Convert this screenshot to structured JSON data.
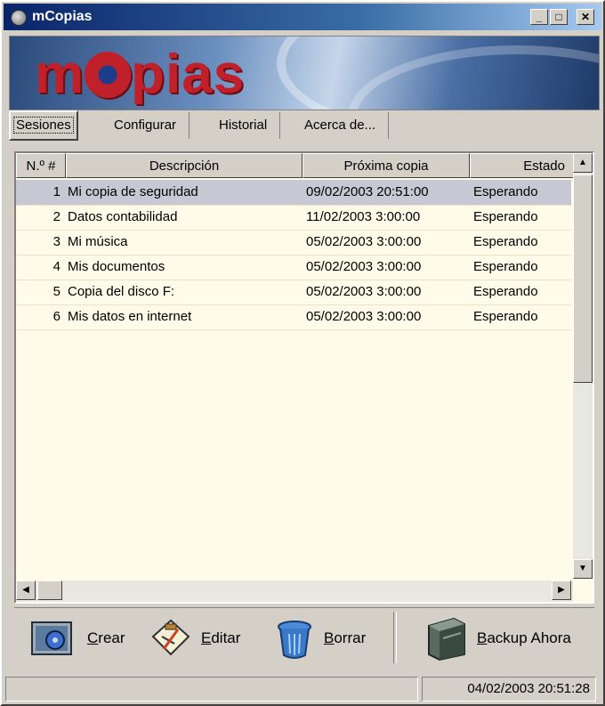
{
  "window": {
    "title": "mCopias"
  },
  "titlebar_buttons": {
    "minimize": "_",
    "maximize": "□",
    "close": "✕"
  },
  "banner": {
    "logo_left": "m",
    "logo_right": "pias"
  },
  "tabs": [
    {
      "label": "Sesiones",
      "active": true
    },
    {
      "label": "Configurar",
      "active": false
    },
    {
      "label": "Historial",
      "active": false
    },
    {
      "label": "Acerca de...",
      "active": false
    }
  ],
  "table": {
    "columns": [
      "N.º #",
      "Descripción",
      "Próxima copia",
      "Estado"
    ],
    "rows": [
      {
        "n": "1",
        "descripcion": "Mi copia de seguridad",
        "proxima": "09/02/2003 20:51:00",
        "estado": "Esperando"
      },
      {
        "n": "2",
        "descripcion": "Datos contabilidad",
        "proxima": "11/02/2003 3:00:00",
        "estado": "Esperando"
      },
      {
        "n": "3",
        "descripcion": "Mi música",
        "proxima": "05/02/2003 3:00:00",
        "estado": "Esperando"
      },
      {
        "n": "4",
        "descripcion": "Mis documentos",
        "proxima": "05/02/2003 3:00:00",
        "estado": "Esperando"
      },
      {
        "n": "5",
        "descripcion": "Copia del disco F:",
        "proxima": "05/02/2003 3:00:00",
        "estado": "Esperando"
      },
      {
        "n": "6",
        "descripcion": "Mis datos en internet",
        "proxima": "05/02/2003 3:00:00",
        "estado": "Esperando"
      }
    ]
  },
  "toolbar": {
    "crear": "Crear",
    "editar": "Editar",
    "borrar": "Borrar",
    "backup": "Backup Ahora"
  },
  "statusbar": {
    "left": "",
    "datetime": "04/02/2003  20:51:28"
  }
}
